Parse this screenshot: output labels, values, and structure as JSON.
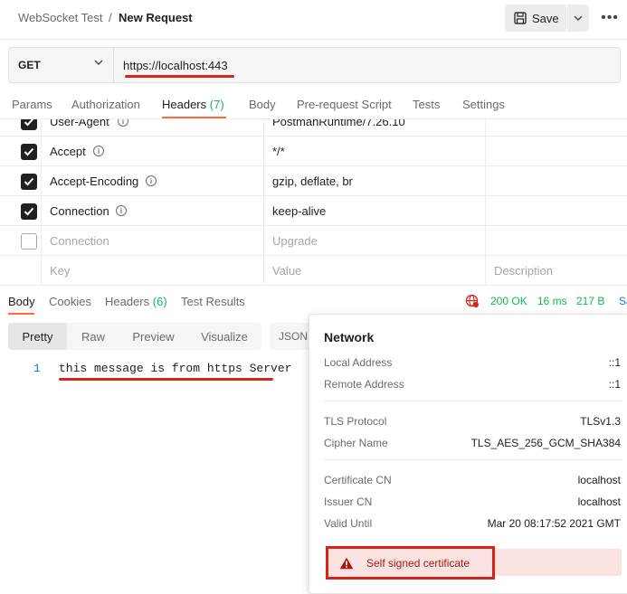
{
  "header": {
    "breadcrumb_parent": "WebSocket Test",
    "breadcrumb_separator": "/",
    "breadcrumb_current": "New Request",
    "save_label": "Save",
    "more_label": "•••"
  },
  "request": {
    "method": "GET",
    "url": "https://localhost:443"
  },
  "request_tabs": [
    {
      "label": "Params"
    },
    {
      "label": "Authorization"
    },
    {
      "label": "Headers",
      "count": "(7)"
    },
    {
      "label": "Body"
    },
    {
      "label": "Pre-request Script"
    },
    {
      "label": "Tests"
    },
    {
      "label": "Settings"
    }
  ],
  "headers_table": {
    "rows": [
      {
        "key": "User-Agent",
        "value": "PostmanRuntime/7.26.10",
        "checked": true
      },
      {
        "key": "Accept",
        "value": "*/*",
        "checked": true
      },
      {
        "key": "Accept-Encoding",
        "value": "gzip, deflate, br",
        "checked": true
      },
      {
        "key": "Connection",
        "value": "keep-alive",
        "checked": true
      },
      {
        "key": "Connection",
        "value": "Upgrade",
        "checked": false
      }
    ],
    "placeholder_key": "Key",
    "placeholder_value": "Value",
    "placeholder_description": "Description"
  },
  "response_tabs": [
    {
      "label": "Body"
    },
    {
      "label": "Cookies"
    },
    {
      "label": "Headers",
      "count": "(6)"
    },
    {
      "label": "Test Results"
    }
  ],
  "response_status": {
    "status": "200 OK",
    "time": "16 ms",
    "size": "217 B",
    "save_label": "Sa"
  },
  "view_tabs": [
    "Pretty",
    "Raw",
    "Preview",
    "Visualize"
  ],
  "format": "JSON",
  "body_lines": [
    {
      "num": "1",
      "text": "this message is from https Server"
    }
  ],
  "network_panel": {
    "title": "Network",
    "local_address_label": "Local Address",
    "local_address": "::1",
    "remote_address_label": "Remote Address",
    "remote_address": "::1",
    "tls_protocol_label": "TLS Protocol",
    "tls_protocol": "TLSv1.3",
    "cipher_name_label": "Cipher Name",
    "cipher_name": "TLS_AES_256_GCM_SHA384",
    "certificate_cn_label": "Certificate CN",
    "certificate_cn": "localhost",
    "issuer_cn_label": "Issuer CN",
    "issuer_cn": "localhost",
    "valid_until_label": "Valid Until",
    "valid_until": "Mar 20 08:17:52 2021 GMT",
    "warning": "Self signed certificate"
  },
  "colors": {
    "accent": "#ff6c37",
    "success": "#0cbb52",
    "annotation_red": "#d8231a"
  }
}
